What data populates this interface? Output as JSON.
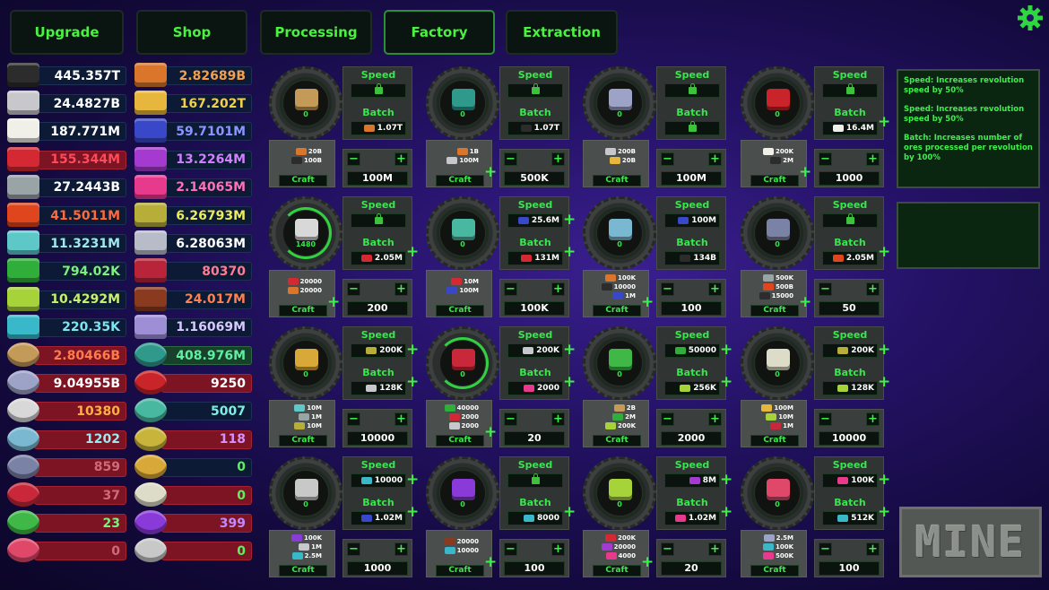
{
  "tabs": [
    {
      "label": "Upgrade",
      "active": false
    },
    {
      "label": "Shop",
      "active": false
    },
    {
      "label": "Processing",
      "active": false
    },
    {
      "label": "Factory",
      "active": true
    },
    {
      "label": "Extraction",
      "active": false
    }
  ],
  "settings_icon": "gear-icon",
  "resources": [
    {
      "value": "445.357T",
      "color": "#2c2c2c",
      "style": "dark"
    },
    {
      "value": "2.82689B",
      "color": "#d9762b",
      "style": "dark"
    },
    {
      "value": "24.4827B",
      "color": "#c8c8cc",
      "style": "dark"
    },
    {
      "value": "167.202T",
      "color": "#e6b73c",
      "style": "dark"
    },
    {
      "value": "187.771M",
      "color": "#f0efe8",
      "style": "dark"
    },
    {
      "value": "59.7101M",
      "color": "#3848c8",
      "style": "dark"
    },
    {
      "value": "155.344M",
      "color": "#d42832",
      "style": "red"
    },
    {
      "value": "13.2264M",
      "color": "#a43ad0",
      "style": "dark"
    },
    {
      "value": "27.2443B",
      "color": "#9aa3a6",
      "style": "dark"
    },
    {
      "value": "2.14065M",
      "color": "#e83a8c",
      "style": "dark"
    },
    {
      "value": "41.5011M",
      "color": "#e0461e",
      "style": "dark"
    },
    {
      "value": "6.26793M",
      "color": "#b7ae3a",
      "style": "dark"
    },
    {
      "value": "11.3231M",
      "color": "#5ec8c8",
      "style": "dark"
    },
    {
      "value": "6.28063M",
      "color": "#b8bcc8",
      "style": "dark"
    },
    {
      "value": "794.02K",
      "color": "#2fae3a",
      "style": "dark"
    },
    {
      "value": "80370",
      "color": "#b8243a",
      "style": "dark"
    },
    {
      "value": "10.4292M",
      "color": "#a6d23a",
      "style": "dark"
    },
    {
      "value": "24.017M",
      "color": "#8a3a1e",
      "style": "dark"
    },
    {
      "value": "220.35K",
      "color": "#38b8c8",
      "style": "dark"
    },
    {
      "value": "1.16069M",
      "color": "#9e8ed6",
      "style": "dark"
    },
    {
      "value": "2.80466B",
      "color": "#c49a58",
      "style": "red"
    },
    {
      "value": "408.976M",
      "color": "#2f9a8c",
      "style": "green"
    },
    {
      "value": "9.04955B",
      "color": "#9da3c6",
      "style": "red"
    },
    {
      "value": "9250",
      "color": "#c8242a",
      "style": "red"
    },
    {
      "value": "10380",
      "color": "#d8d8d8",
      "style": "red"
    },
    {
      "value": "5007",
      "color": "#48b8a0",
      "style": "dark"
    },
    {
      "value": "1202",
      "color": "#7ab8d2",
      "style": "red"
    },
    {
      "value": "118",
      "color": "#c8b43a",
      "style": "red"
    },
    {
      "value": "859",
      "color": "#7a82a6",
      "style": "red"
    },
    {
      "value": "0",
      "color": "#d8a838",
      "style": "dark"
    },
    {
      "value": "37",
      "color": "#c8283a",
      "style": "red"
    },
    {
      "value": "0",
      "color": "#dcdcc8",
      "style": "red"
    },
    {
      "value": "23",
      "color": "#40b848",
      "style": "red"
    },
    {
      "value": "399",
      "color": "#8a3ad8",
      "style": "red"
    },
    {
      "value": "0",
      "color": "#e0486a",
      "style": "red"
    },
    {
      "value": "0",
      "color": "#c8c8c8",
      "style": "red"
    }
  ],
  "machines": [
    {
      "mat": "#c49a58",
      "level": "0",
      "on": false,
      "speed_lock": true,
      "speed_val": "",
      "speed_sw": "",
      "speed_plus": false,
      "batch_val": "1.07T",
      "batch_sw": "#d9762b",
      "batch_plus": false,
      "reqs": [
        {
          "t": "20B",
          "c": "#d9762b"
        },
        {
          "t": "100B",
          "c": "#2c2c2c"
        }
      ],
      "craft_plus": false,
      "count": "100M"
    },
    {
      "mat": "#2f9a8c",
      "level": "0",
      "on": false,
      "speed_lock": true,
      "speed_val": "",
      "speed_sw": "",
      "speed_plus": false,
      "batch_val": "1.07T",
      "batch_sw": "#2c2c2c",
      "batch_plus": false,
      "reqs": [
        {
          "t": "1B",
          "c": "#d9762b"
        },
        {
          "t": "100M",
          "c": "#c8c8cc"
        }
      ],
      "craft_plus": true,
      "count": "500K"
    },
    {
      "mat": "#9da3c6",
      "level": "0",
      "on": false,
      "speed_lock": true,
      "speed_val": "",
      "speed_sw": "",
      "speed_plus": false,
      "batch_val": "",
      "batch_sw": "",
      "batch_plus": false,
      "batch_lock": true,
      "reqs": [
        {
          "t": "200B",
          "c": "#c8c8cc"
        },
        {
          "t": "20B",
          "c": "#e6b73c"
        }
      ],
      "craft_plus": false,
      "count": "100M"
    },
    {
      "mat": "#c8242a",
      "level": "0",
      "on": false,
      "speed_lock": true,
      "speed_val": "",
      "speed_sw": "",
      "speed_plus": false,
      "batch_val": "16.4M",
      "batch_sw": "#f0efe8",
      "batch_plus": true,
      "reqs": [
        {
          "t": "200K",
          "c": "#f0efe8"
        },
        {
          "t": "2M",
          "c": "#2c2c2c"
        }
      ],
      "craft_plus": true,
      "count": "1000"
    },
    {
      "mat": "#d8d8d8",
      "level": "1480",
      "on": true,
      "speed_lock": true,
      "speed_val": "",
      "speed_sw": "",
      "speed_plus": false,
      "batch_val": "2.05M",
      "batch_sw": "#d42832",
      "batch_plus": true,
      "reqs": [
        {
          "t": "20000",
          "c": "#d42832"
        },
        {
          "t": "20000",
          "c": "#d9762b"
        }
      ],
      "craft_plus": true,
      "count": "200"
    },
    {
      "mat": "#48b8a0",
      "level": "0",
      "on": false,
      "speed_lock": false,
      "speed_val": "25.6M",
      "speed_sw": "#3848c8",
      "speed_plus": true,
      "batch_val": "131M",
      "batch_sw": "#d42832",
      "batch_plus": true,
      "reqs": [
        {
          "t": "10M",
          "c": "#d42832"
        },
        {
          "t": "100M",
          "c": "#3848c8"
        }
      ],
      "craft_plus": false,
      "count": "100K"
    },
    {
      "mat": "#7ab8d2",
      "level": "0",
      "on": false,
      "speed_lock": false,
      "speed_val": "100M",
      "speed_sw": "#3848c8",
      "speed_plus": false,
      "batch_val": "134B",
      "batch_sw": "#2c2c2c",
      "batch_plus": false,
      "reqs": [
        {
          "t": "100K",
          "c": "#d9762b"
        },
        {
          "t": "10000",
          "c": "#2c2c2c"
        },
        {
          "t": "1M",
          "c": "#3848c8"
        }
      ],
      "craft_plus": true,
      "count": "100"
    },
    {
      "mat": "#7a82a6",
      "level": "0",
      "on": false,
      "speed_lock": true,
      "speed_val": "",
      "speed_sw": "",
      "speed_plus": false,
      "batch_val": "2.05M",
      "batch_sw": "#e0461e",
      "batch_plus": true,
      "reqs": [
        {
          "t": "500K",
          "c": "#9aa3a6"
        },
        {
          "t": "500B",
          "c": "#e0461e"
        },
        {
          "t": "15000",
          "c": "#2c2c2c"
        }
      ],
      "craft_plus": true,
      "count": "50"
    },
    {
      "mat": "#d8a838",
      "level": "0",
      "on": false,
      "speed_lock": false,
      "speed_val": "200K",
      "speed_sw": "#b7ae3a",
      "speed_plus": true,
      "batch_val": "128K",
      "batch_sw": "#c8c8cc",
      "batch_plus": true,
      "reqs": [
        {
          "t": "10M",
          "c": "#5ec8c8"
        },
        {
          "t": "1M",
          "c": "#9aa3a6"
        },
        {
          "t": "10M",
          "c": "#b7ae3a"
        }
      ],
      "craft_plus": false,
      "count": "10000"
    },
    {
      "mat": "#c8283a",
      "level": "0",
      "on": true,
      "speed_lock": false,
      "speed_val": "200K",
      "speed_sw": "#c8c8cc",
      "speed_plus": true,
      "batch_val": "2000",
      "batch_sw": "#e83a8c",
      "batch_plus": true,
      "reqs": [
        {
          "t": "40000",
          "c": "#2fae3a"
        },
        {
          "t": "2000",
          "c": "#d42832"
        },
        {
          "t": "2000",
          "c": "#c8c8cc"
        }
      ],
      "craft_plus": true,
      "count": "20"
    },
    {
      "mat": "#40b848",
      "level": "0",
      "on": false,
      "speed_lock": false,
      "speed_val": "50000",
      "speed_sw": "#2fae3a",
      "speed_plus": true,
      "batch_val": "256K",
      "batch_sw": "#a6d23a",
      "batch_plus": true,
      "reqs": [
        {
          "t": "2B",
          "c": "#c49a58"
        },
        {
          "t": "2M",
          "c": "#2fae3a"
        },
        {
          "t": "200K",
          "c": "#a6d23a"
        }
      ],
      "craft_plus": false,
      "count": "2000"
    },
    {
      "mat": "#dcdcc8",
      "level": "0",
      "on": false,
      "speed_lock": false,
      "speed_val": "200K",
      "speed_sw": "#b7ae3a",
      "speed_plus": true,
      "batch_val": "128K",
      "batch_sw": "#a6d23a",
      "batch_plus": true,
      "reqs": [
        {
          "t": "100M",
          "c": "#e6b73c"
        },
        {
          "t": "10M",
          "c": "#a6d23a"
        },
        {
          "t": "1M",
          "c": "#c8283a"
        }
      ],
      "craft_plus": false,
      "count": "10000"
    },
    {
      "mat": "#c8c8c8",
      "level": "0",
      "on": false,
      "speed_lock": false,
      "speed_val": "10000",
      "speed_sw": "#38b8c8",
      "speed_plus": true,
      "batch_val": "1.02M",
      "batch_sw": "#3848c8",
      "batch_plus": true,
      "reqs": [
        {
          "t": "100K",
          "c": "#8a3ad8"
        },
        {
          "t": "1M",
          "c": "#c8c8cc"
        },
        {
          "t": "2.5M",
          "c": "#38b8c8"
        }
      ],
      "craft_plus": false,
      "count": "1000"
    },
    {
      "mat": "#8a3ad8",
      "level": "0",
      "on": false,
      "speed_lock": true,
      "speed_val": "",
      "speed_sw": "",
      "speed_plus": false,
      "batch_val": "8000",
      "batch_sw": "#38b8c8",
      "batch_plus": true,
      "reqs": [
        {
          "t": "20000",
          "c": "#8a3a1e"
        },
        {
          "t": "10000",
          "c": "#38b8c8"
        }
      ],
      "craft_plus": true,
      "count": "100"
    },
    {
      "mat": "#a6d23a",
      "level": "0",
      "on": false,
      "speed_lock": false,
      "speed_val": "8M",
      "speed_sw": "#a43ad0",
      "speed_plus": true,
      "batch_val": "1.02M",
      "batch_sw": "#e83a8c",
      "batch_plus": true,
      "reqs": [
        {
          "t": "200K",
          "c": "#d42832"
        },
        {
          "t": "20000",
          "c": "#a43ad0"
        },
        {
          "t": "4000",
          "c": "#e83a8c"
        }
      ],
      "craft_plus": true,
      "count": "20"
    },
    {
      "mat": "#e0486a",
      "level": "0",
      "on": false,
      "speed_lock": false,
      "speed_val": "100K",
      "speed_sw": "#e83a8c",
      "speed_plus": true,
      "batch_val": "512K",
      "batch_sw": "#38b8c8",
      "batch_plus": true,
      "reqs": [
        {
          "t": "2.5M",
          "c": "#9da3c6"
        },
        {
          "t": "100K",
          "c": "#38b8c8"
        },
        {
          "t": "500K",
          "c": "#e83a8c"
        }
      ],
      "craft_plus": false,
      "count": "100"
    }
  ],
  "labels": {
    "speed": "Speed",
    "batch": "Batch",
    "craft": "Craft",
    "minus": "−",
    "plus": "+"
  },
  "info": {
    "lines": [
      "Speed: Increases revolution speed by 50%",
      "Speed: Increases revolution speed by 50%",
      "Batch: Increases number of ores processed per revolution by 100%"
    ]
  },
  "mine_label": "MINE"
}
